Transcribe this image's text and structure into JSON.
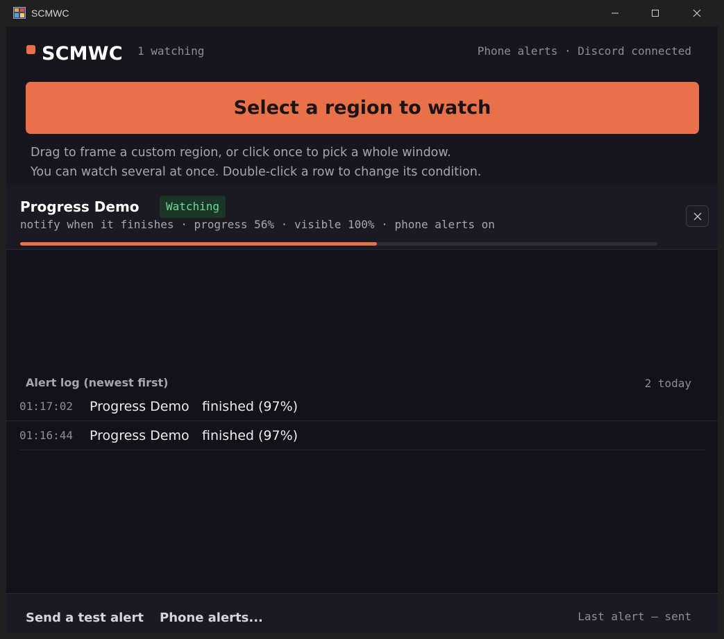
{
  "window": {
    "title": "SCMWC",
    "icon": "app-icon",
    "controls": [
      "minimize-icon",
      "maximize-icon",
      "close-icon"
    ]
  },
  "header": {
    "logo_text": "SCMWC",
    "watching_count": "1 watching",
    "connection_status": "Phone alerts · Discord connected"
  },
  "select_button": {
    "label": "Select a region to watch"
  },
  "help": {
    "line1": "Drag to frame a custom region, or click once to pick a whole window.",
    "line2": "You can watch several at once. Double-click a row to change its condition."
  },
  "watches": [
    {
      "name": "Progress Demo",
      "status": "Watching",
      "meta": "notify when it finishes · progress 56% · visible 100% · phone alerts on",
      "progress": 0.56
    }
  ],
  "alert_log": {
    "title": "Alert log (newest first)",
    "count": "2 today",
    "entries": [
      {
        "time": "01:17:02",
        "name": "Progress Demo",
        "message": "finished (97%)"
      },
      {
        "time": "01:16:44",
        "name": "Progress Demo",
        "message": "finished (97%)"
      }
    ]
  },
  "footer": {
    "test_alert_label": "Send a test alert",
    "phone_alerts_label": "Phone alerts...",
    "last_alert": "Last alert — sent"
  },
  "colors": {
    "accent": "#e8714a",
    "background": "#131218",
    "panel": "#1b1a22",
    "badge_bg": "#1b3527",
    "badge_text": "#6bd99a"
  }
}
